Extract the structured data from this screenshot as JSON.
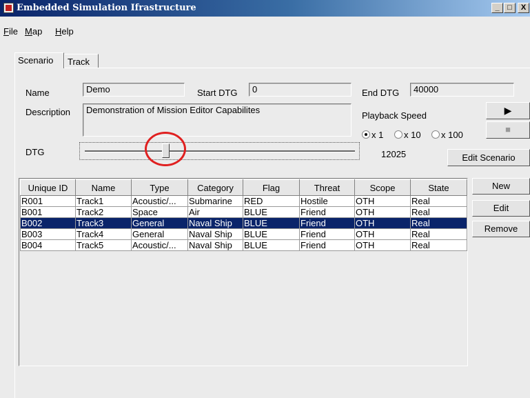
{
  "window": {
    "title": "Embedded Simulation Ifrastructure",
    "controls": [
      "_",
      "□",
      "X"
    ]
  },
  "menu": [
    {
      "first": "F",
      "rest": "ile"
    },
    {
      "first": "M",
      "rest": "ap"
    },
    {
      "first": "H",
      "rest": "elp"
    }
  ],
  "tabs": {
    "scenario": "Scenario",
    "track": "Track",
    "active": "Scenario"
  },
  "form": {
    "name_label": "Name",
    "name_value": "Demo",
    "start_label": "Start DTG",
    "start_value": "0",
    "end_label": "End DTG",
    "end_value": "40000",
    "desc_label": "Description",
    "desc_value": "Demonstration of Mission Editor Capabilites",
    "speed_label": "Playback Speed",
    "speed_options": [
      "x 1",
      "x 10",
      "x 100"
    ],
    "speed_selected": "x 1",
    "dtg_label": "DTG",
    "dtg_value": "12025",
    "dtg_min": 0,
    "dtg_max": 40000
  },
  "buttons": {
    "play": "▶",
    "stop": "■",
    "edit_scenario": "Edit Scenario",
    "new": "New",
    "edit": "Edit",
    "remove": "Remove"
  },
  "table": {
    "headers": [
      "Unique ID",
      "Name",
      "Type",
      "Category",
      "Flag",
      "Threat",
      "Scope",
      "State"
    ],
    "rows": [
      [
        "R001",
        "Track1",
        "Acoustic/...",
        "Submarine",
        "RED",
        "Hostile",
        "OTH",
        "Real"
      ],
      [
        "B001",
        "Track2",
        "Space",
        "Air",
        "BLUE",
        "Friend",
        "OTH",
        "Real"
      ],
      [
        "B002",
        "Track3",
        "General",
        "Naval Ship",
        "BLUE",
        "Friend",
        "OTH",
        "Real"
      ],
      [
        "B003",
        "Track4",
        "General",
        "Naval Ship",
        "BLUE",
        "Friend",
        "OTH",
        "Real"
      ],
      [
        "B004",
        "Track5",
        "Acoustic/...",
        "Naval Ship",
        "BLUE",
        "Friend",
        "OTH",
        "Real"
      ]
    ],
    "selected_row": 2
  },
  "colors": {
    "selection": "#0a246a",
    "highlight_circle": "#e02020"
  }
}
